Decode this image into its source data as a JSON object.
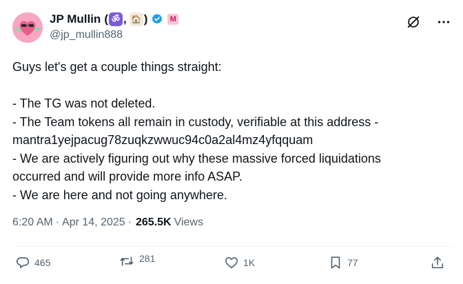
{
  "author": {
    "name": "JP Mullin",
    "name_open": "(",
    "name_emoji_1": "ॐ",
    "name_sep": ",",
    "name_emoji_2": "🏠",
    "name_close": ")",
    "badge_letter": "M",
    "handle": "@jp_mullin888"
  },
  "post": {
    "text": "Guys let's get a couple things straight:\n\n- The TG was not deleted.\n- The Team tokens all remain in custody, verifiable at this address -\nmantra1yejpacug78zuqkzwwuc94c0a2al4mz4yfqquam\n- We are actively figuring out why these massive forced liquidations\noccurred and will provide more info ASAP.\n- We are here and not going anywhere.",
    "time": "6:20 AM",
    "separator": "·",
    "date": "Apr 14, 2025",
    "views_count": "265.5K",
    "views_label": "Views"
  },
  "actions": {
    "replies": "465",
    "reposts": "281",
    "likes": "1K",
    "bookmarks": "77"
  },
  "icons": [
    "grok-icon",
    "more-icon",
    "reply-icon",
    "repost-icon",
    "like-icon",
    "bookmark-icon",
    "share-icon",
    "verified-badge-icon"
  ],
  "colors": {
    "verified": "#1d9bf0",
    "muted": "#536471",
    "text": "#0f1419"
  }
}
